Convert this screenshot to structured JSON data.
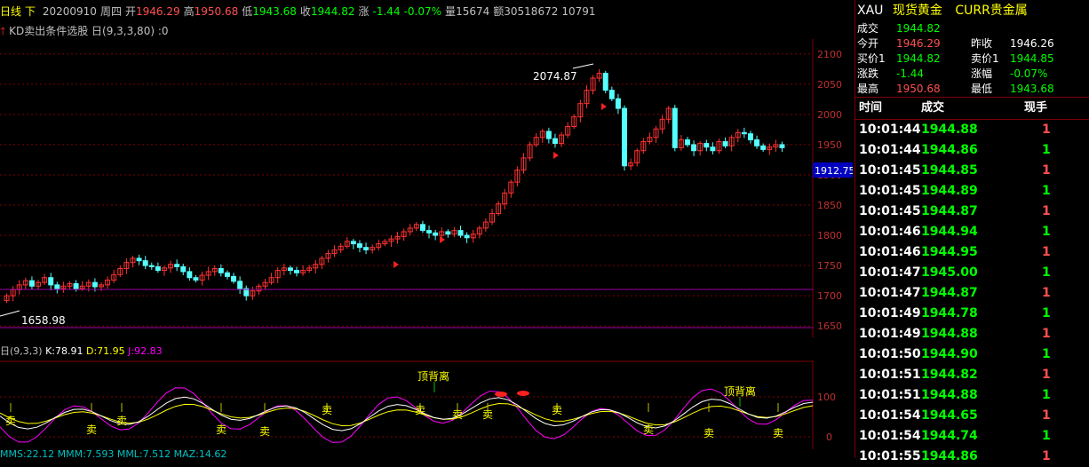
{
  "header": {
    "period": "日线",
    "period_nav": "下",
    "date": "20200910",
    "weekday": "周四",
    "open_label": "开",
    "open": "1946.29",
    "high_label": "高",
    "high": "1950.68",
    "low_label": "低",
    "low": "1943.68",
    "close_label": "收",
    "close": "1944.82",
    "change_label": "涨",
    "change": "-1.44",
    "change_pct": "-0.07%",
    "volume_label": "量",
    "volume": "15674",
    "amount_label": "额",
    "amount": "30518672",
    "extra": "10791"
  },
  "indicator": {
    "name": "KD卖出条件选股",
    "params": "日(9,3,3,80)",
    "value": ":0"
  },
  "main_chart": {
    "price_axis": [
      "2100",
      "2050",
      "2000",
      "1950",
      "1900",
      "1850",
      "1800",
      "1750",
      "1700",
      "1650"
    ],
    "current_price_tag": "1912.75",
    "high_annotation": "2074.87",
    "low_annotation": "1658.98"
  },
  "kd_panel": {
    "params": "日(9,3,3)",
    "k_label": "K:78.91",
    "d_label": "D:71.95",
    "j_label": "J:92.83",
    "axis": [
      "100",
      "0"
    ],
    "divergence_text": "顶背离",
    "sell_text": "卖"
  },
  "bottom": {
    "text": "MMS:22.12  MMM:7.593  MML:7.512  MAZ:14.62"
  },
  "quote": {
    "symbol": "XAU",
    "name": "现货黄金",
    "category": "CURR贵金属",
    "rows": [
      {
        "l1": "成交",
        "v1": "1944.82",
        "l2": "",
        "v2": ""
      },
      {
        "l1": "今开",
        "v1": "1946.29",
        "l2": "昨收",
        "v2": "1946.26"
      },
      {
        "l1": "买价1",
        "v1": "1944.82",
        "l2": "卖价1",
        "v2": "1944.85"
      },
      {
        "l1": "涨跌",
        "v1": "-1.44",
        "l2": "涨幅",
        "v2": "-0.07%"
      },
      {
        "l1": "最高",
        "v1": "1950.68",
        "l2": "最低",
        "v2": "1943.68"
      }
    ]
  },
  "trades": {
    "headers": [
      "时间",
      "成交",
      "现手"
    ],
    "rows": [
      {
        "time": "10:01:44",
        "price": "1944.88",
        "qty": "1"
      },
      {
        "time": "10:01:44",
        "price": "1944.86",
        "qty": "1"
      },
      {
        "time": "10:01:45",
        "price": "1944.85",
        "qty": "1"
      },
      {
        "time": "10:01:45",
        "price": "1944.89",
        "qty": "1"
      },
      {
        "time": "10:01:45",
        "price": "1944.87",
        "qty": "1"
      },
      {
        "time": "10:01:46",
        "price": "1944.94",
        "qty": "1"
      },
      {
        "time": "10:01:46",
        "price": "1944.95",
        "qty": "1"
      },
      {
        "time": "10:01:47",
        "price": "1945.00",
        "qty": "1"
      },
      {
        "time": "10:01:47",
        "price": "1944.87",
        "qty": "1"
      },
      {
        "time": "10:01:49",
        "price": "1944.78",
        "qty": "1"
      },
      {
        "time": "10:01:49",
        "price": "1944.88",
        "qty": "1"
      },
      {
        "time": "10:01:50",
        "price": "1944.90",
        "qty": "1"
      },
      {
        "time": "10:01:51",
        "price": "1944.82",
        "qty": "1"
      },
      {
        "time": "10:01:51",
        "price": "1944.88",
        "qty": "1"
      },
      {
        "time": "10:01:54",
        "price": "1944.65",
        "qty": "1"
      },
      {
        "time": "10:01:54",
        "price": "1944.74",
        "qty": "1"
      },
      {
        "time": "10:01:55",
        "price": "1944.86",
        "qty": "1"
      }
    ]
  },
  "chart_data": {
    "type": "candlestick",
    "price_range": [
      1640,
      2110
    ],
    "closes": [
      1700,
      1710,
      1718,
      1725,
      1716,
      1722,
      1730,
      1718,
      1712,
      1716,
      1720,
      1712,
      1716,
      1722,
      1715,
      1718,
      1726,
      1735,
      1745,
      1755,
      1762,
      1758,
      1750,
      1748,
      1742,
      1746,
      1752,
      1748,
      1740,
      1730,
      1726,
      1734,
      1740,
      1745,
      1738,
      1732,
      1724,
      1712,
      1700,
      1708,
      1716,
      1722,
      1730,
      1742,
      1746,
      1742,
      1738,
      1742,
      1746,
      1752,
      1762,
      1770,
      1776,
      1782,
      1790,
      1786,
      1780,
      1776,
      1780,
      1786,
      1790,
      1794,
      1798,
      1806,
      1812,
      1818,
      1808,
      1804,
      1800,
      1806,
      1802,
      1808,
      1800,
      1796,
      1802,
      1812,
      1822,
      1836,
      1852,
      1870,
      1888,
      1908,
      1928,
      1950,
      1962,
      1972,
      1960,
      1952,
      1966,
      1980,
      1996,
      2018,
      2040,
      2060,
      2068,
      2040,
      2026,
      2010,
      1915,
      1920,
      1940,
      1955,
      1962,
      1976,
      1992,
      2010,
      1945,
      1958,
      1950,
      1940,
      1952,
      1946,
      1940,
      1955,
      1948,
      1962,
      1970,
      1968,
      1958,
      1948,
      1942,
      1946,
      1950,
      1945
    ]
  },
  "colors": {
    "up": "#ff3232",
    "down": "#54ffff",
    "grid": "#800000",
    "k_line": "#ffffff",
    "d_line": "#ffff00",
    "j_line": "#ff00ff",
    "axis_text": "#c03030",
    "price_up": "#ff5050",
    "price_down": "#00ff00"
  }
}
